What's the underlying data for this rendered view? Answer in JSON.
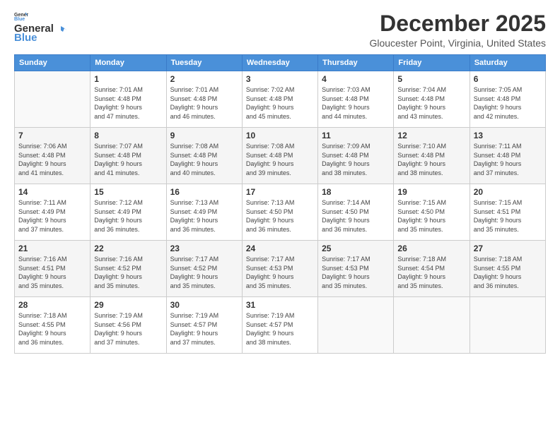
{
  "logo": {
    "line1": "General",
    "line2": "Blue"
  },
  "title": "December 2025",
  "subtitle": "Gloucester Point, Virginia, United States",
  "days_of_week": [
    "Sunday",
    "Monday",
    "Tuesday",
    "Wednesday",
    "Thursday",
    "Friday",
    "Saturday"
  ],
  "weeks": [
    [
      {
        "day": "",
        "info": ""
      },
      {
        "day": "1",
        "info": "Sunrise: 7:01 AM\nSunset: 4:48 PM\nDaylight: 9 hours\nand 47 minutes."
      },
      {
        "day": "2",
        "info": "Sunrise: 7:01 AM\nSunset: 4:48 PM\nDaylight: 9 hours\nand 46 minutes."
      },
      {
        "day": "3",
        "info": "Sunrise: 7:02 AM\nSunset: 4:48 PM\nDaylight: 9 hours\nand 45 minutes."
      },
      {
        "day": "4",
        "info": "Sunrise: 7:03 AM\nSunset: 4:48 PM\nDaylight: 9 hours\nand 44 minutes."
      },
      {
        "day": "5",
        "info": "Sunrise: 7:04 AM\nSunset: 4:48 PM\nDaylight: 9 hours\nand 43 minutes."
      },
      {
        "day": "6",
        "info": "Sunrise: 7:05 AM\nSunset: 4:48 PM\nDaylight: 9 hours\nand 42 minutes."
      }
    ],
    [
      {
        "day": "7",
        "info": "Sunrise: 7:06 AM\nSunset: 4:48 PM\nDaylight: 9 hours\nand 41 minutes."
      },
      {
        "day": "8",
        "info": "Sunrise: 7:07 AM\nSunset: 4:48 PM\nDaylight: 9 hours\nand 41 minutes."
      },
      {
        "day": "9",
        "info": "Sunrise: 7:08 AM\nSunset: 4:48 PM\nDaylight: 9 hours\nand 40 minutes."
      },
      {
        "day": "10",
        "info": "Sunrise: 7:08 AM\nSunset: 4:48 PM\nDaylight: 9 hours\nand 39 minutes."
      },
      {
        "day": "11",
        "info": "Sunrise: 7:09 AM\nSunset: 4:48 PM\nDaylight: 9 hours\nand 38 minutes."
      },
      {
        "day": "12",
        "info": "Sunrise: 7:10 AM\nSunset: 4:48 PM\nDaylight: 9 hours\nand 38 minutes."
      },
      {
        "day": "13",
        "info": "Sunrise: 7:11 AM\nSunset: 4:48 PM\nDaylight: 9 hours\nand 37 minutes."
      }
    ],
    [
      {
        "day": "14",
        "info": "Sunrise: 7:11 AM\nSunset: 4:49 PM\nDaylight: 9 hours\nand 37 minutes."
      },
      {
        "day": "15",
        "info": "Sunrise: 7:12 AM\nSunset: 4:49 PM\nDaylight: 9 hours\nand 36 minutes."
      },
      {
        "day": "16",
        "info": "Sunrise: 7:13 AM\nSunset: 4:49 PM\nDaylight: 9 hours\nand 36 minutes."
      },
      {
        "day": "17",
        "info": "Sunrise: 7:13 AM\nSunset: 4:50 PM\nDaylight: 9 hours\nand 36 minutes."
      },
      {
        "day": "18",
        "info": "Sunrise: 7:14 AM\nSunset: 4:50 PM\nDaylight: 9 hours\nand 36 minutes."
      },
      {
        "day": "19",
        "info": "Sunrise: 7:15 AM\nSunset: 4:50 PM\nDaylight: 9 hours\nand 35 minutes."
      },
      {
        "day": "20",
        "info": "Sunrise: 7:15 AM\nSunset: 4:51 PM\nDaylight: 9 hours\nand 35 minutes."
      }
    ],
    [
      {
        "day": "21",
        "info": "Sunrise: 7:16 AM\nSunset: 4:51 PM\nDaylight: 9 hours\nand 35 minutes."
      },
      {
        "day": "22",
        "info": "Sunrise: 7:16 AM\nSunset: 4:52 PM\nDaylight: 9 hours\nand 35 minutes."
      },
      {
        "day": "23",
        "info": "Sunrise: 7:17 AM\nSunset: 4:52 PM\nDaylight: 9 hours\nand 35 minutes."
      },
      {
        "day": "24",
        "info": "Sunrise: 7:17 AM\nSunset: 4:53 PM\nDaylight: 9 hours\nand 35 minutes."
      },
      {
        "day": "25",
        "info": "Sunrise: 7:17 AM\nSunset: 4:53 PM\nDaylight: 9 hours\nand 35 minutes."
      },
      {
        "day": "26",
        "info": "Sunrise: 7:18 AM\nSunset: 4:54 PM\nDaylight: 9 hours\nand 35 minutes."
      },
      {
        "day": "27",
        "info": "Sunrise: 7:18 AM\nSunset: 4:55 PM\nDaylight: 9 hours\nand 36 minutes."
      }
    ],
    [
      {
        "day": "28",
        "info": "Sunrise: 7:18 AM\nSunset: 4:55 PM\nDaylight: 9 hours\nand 36 minutes."
      },
      {
        "day": "29",
        "info": "Sunrise: 7:19 AM\nSunset: 4:56 PM\nDaylight: 9 hours\nand 37 minutes."
      },
      {
        "day": "30",
        "info": "Sunrise: 7:19 AM\nSunset: 4:57 PM\nDaylight: 9 hours\nand 37 minutes."
      },
      {
        "day": "31",
        "info": "Sunrise: 7:19 AM\nSunset: 4:57 PM\nDaylight: 9 hours\nand 38 minutes."
      },
      {
        "day": "",
        "info": ""
      },
      {
        "day": "",
        "info": ""
      },
      {
        "day": "",
        "info": ""
      }
    ]
  ]
}
